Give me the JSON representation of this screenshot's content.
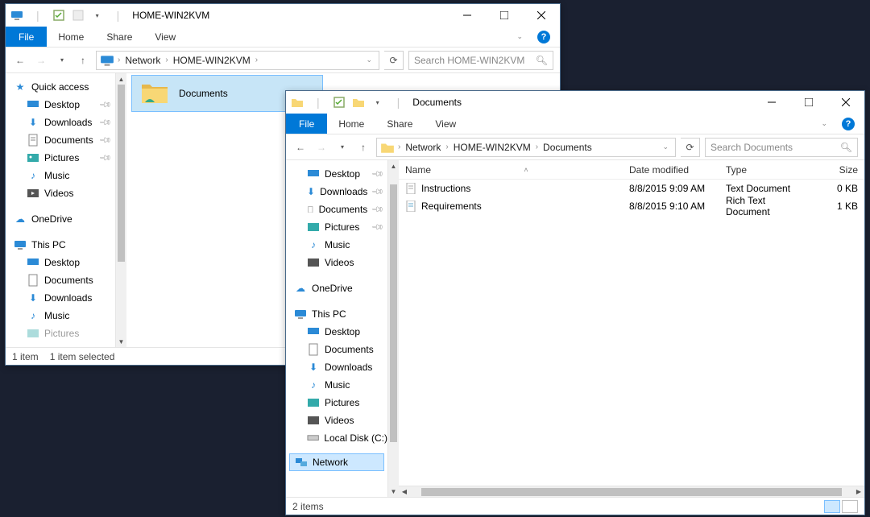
{
  "win1": {
    "title": "HOME-WIN2KVM",
    "tabs": {
      "file": "File",
      "home": "Home",
      "share": "Share",
      "view": "View"
    },
    "breadcrumb": {
      "net": "Network",
      "host": "HOME-WIN2KVM"
    },
    "search_placeholder": "Search HOME-WIN2KVM",
    "nav": {
      "quick": "Quick access",
      "desktop": "Desktop",
      "downloads": "Downloads",
      "documents": "Documents",
      "pictures": "Pictures",
      "music": "Music",
      "videos": "Videos",
      "onedrive": "OneDrive",
      "thispc": "This PC",
      "pictures2": "Pictures"
    },
    "tile_label": "Documents",
    "status_items": "1 item",
    "status_sel": "1 item selected"
  },
  "win2": {
    "title": "Documents",
    "tabs": {
      "file": "File",
      "home": "Home",
      "share": "Share",
      "view": "View"
    },
    "breadcrumb": {
      "net": "Network",
      "host": "HOME-WIN2KVM",
      "dir": "Documents"
    },
    "search_placeholder": "Search Documents",
    "nav": {
      "desktop": "Desktop",
      "downloads": "Downloads",
      "documents": "Documents",
      "pictures": "Pictures",
      "music": "Music",
      "videos": "Videos",
      "onedrive": "OneDrive",
      "thispc": "This PC",
      "desktop2": "Desktop",
      "documents2": "Documents",
      "downloads2": "Downloads",
      "music2": "Music",
      "pictures2": "Pictures",
      "videos2": "Videos",
      "localdisk": "Local Disk (C:)",
      "network": "Network"
    },
    "columns": {
      "name": "Name",
      "date": "Date modified",
      "type": "Type",
      "size": "Size"
    },
    "rows": [
      {
        "name": "Instructions",
        "date": "8/8/2015 9:09 AM",
        "type": "Text Document",
        "size": "0 KB"
      },
      {
        "name": "Requirements",
        "date": "8/8/2015 9:10 AM",
        "type": "Rich Text Document",
        "size": "1 KB"
      }
    ],
    "status_items": "2 items"
  }
}
